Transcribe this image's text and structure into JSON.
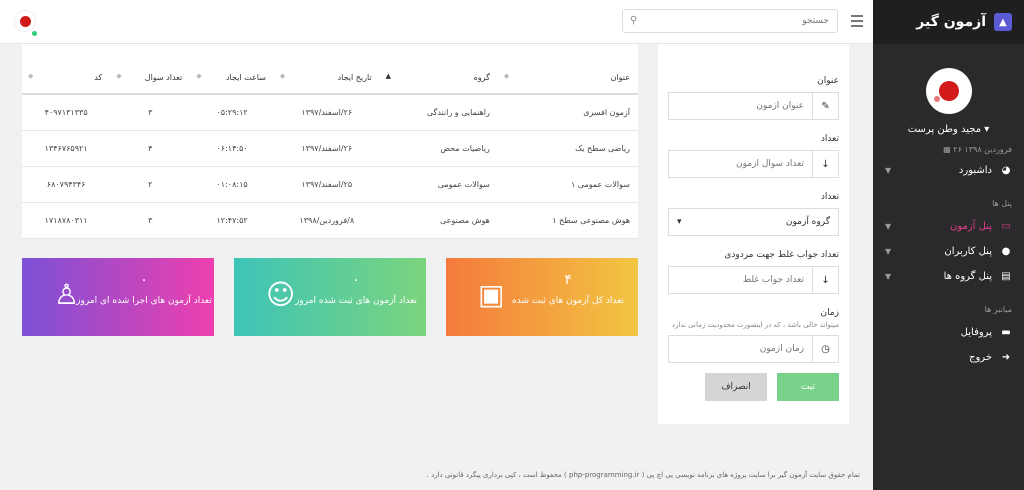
{
  "sidebar": {
    "brand": "آزمون گیر",
    "username": "مجید وطن پرست",
    "date": "۲۶ فروردین ۱۳۹۸",
    "dashboard": "داشبورد",
    "section_panels": "پنل ها",
    "items": [
      {
        "label": "پنل آزمون"
      },
      {
        "label": "پنل کاربران"
      },
      {
        "label": "پنل گروه ها"
      }
    ],
    "section_shortcuts": "میانبر ها",
    "profile": "پروفایل",
    "logout": "خروج"
  },
  "topbar": {
    "search_placeholder": "جستجو"
  },
  "form": {
    "title_label": "عنوان",
    "title_placeholder": "عنوان آزمون",
    "count_label": "تعداد",
    "count_placeholder": "تعداد سوال آزمون",
    "group_label": "تعداد",
    "group_selected": "گروه آزمون",
    "wrong_label": "تعداد جواب غلط جهت مردودی",
    "wrong_placeholder": "تعداد جواب غلط",
    "time_label": "زمان",
    "time_hint": "میتواند خالی باشد ، که در اینصورت محدودیت زمانی ندارد",
    "time_placeholder": "زمان آزمون",
    "submit": "ثبت",
    "cancel": "انصراف"
  },
  "table": {
    "headers": [
      "عنوان",
      "گروه",
      "تاریخ ایجاد",
      "ساعت ایجاد",
      "تعداد سوال",
      "کد"
    ],
    "rows": [
      [
        "آزمون افسری",
        "راهنمایی و رانندگی",
        "۲۶/اسفند/۱۳۹۷",
        "۰۵:۲۹:۱۲",
        "۳",
        "۴۰۹۷۱۳۱۳۳۵"
      ],
      [
        "ریاضی سطح یک",
        "ریاضیات محض",
        "۲۶/اسفند/۱۳۹۷",
        "۰۶:۱۴:۵۰",
        "۴",
        "۱۳۴۶۷۶۵۹۲۱"
      ],
      [
        "سوالات عمومی ۱",
        "سوالات عمومی",
        "۲۵/اسفند/۱۳۹۷",
        "۰۱:۰۸:۱۵",
        "۲",
        "۶۸۰۷۹۴۳۴۶"
      ],
      [
        "هوش مصنوعی سطح ۱",
        "هوش مصنوعی",
        "۸/فروردین/۱۳۹۸",
        "۱۲:۴۷:۵۲",
        "۳",
        "۱۷۱۸۷۸۰۳۱۱"
      ]
    ]
  },
  "tiles": [
    {
      "value": "۴",
      "label": "تعداد کل آزمون های ثبت شده",
      "icon": "newspaper-icon"
    },
    {
      "value": "۰",
      "label": "تعداد آزمون های ثبت شده امروز",
      "icon": "reddit-icon"
    },
    {
      "value": "۰",
      "label": "تعداد آزمون های اجرا شده ای امروز",
      "icon": "user-check-icon"
    }
  ],
  "footer": "تمام حقوق سایت آزمون گیر برا سایت پروژه های برنامه نویسی پی اچ پی ( php-programming.ir ) محفوظ است ، کپی برداری پیگرد قانونی دارد ."
}
